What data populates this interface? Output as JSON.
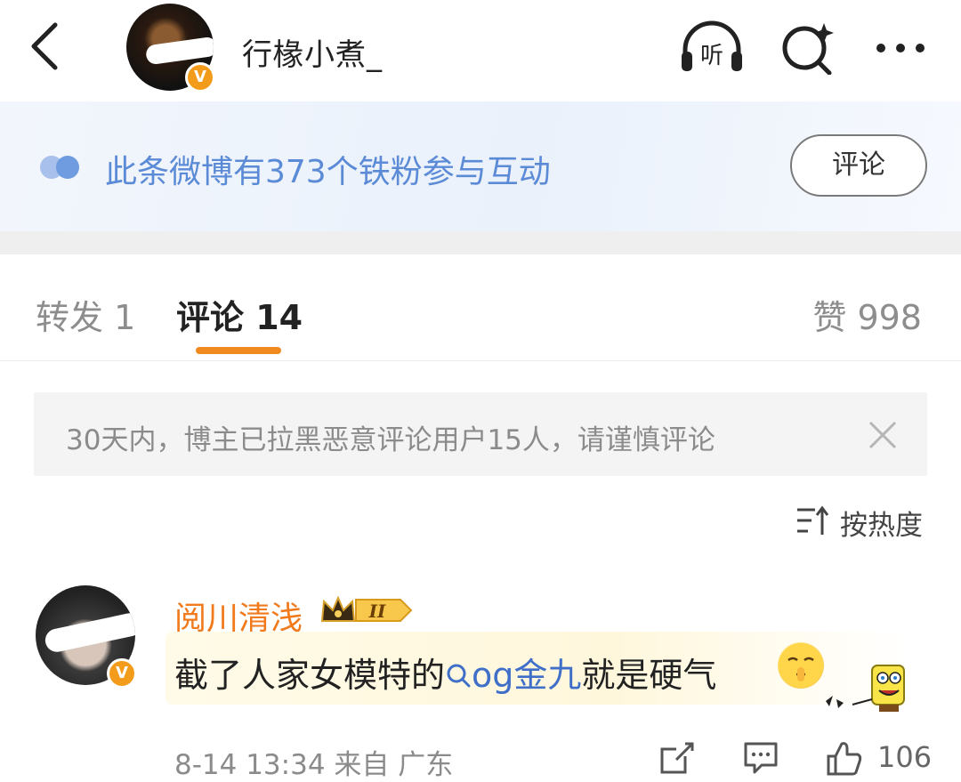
{
  "header": {
    "username": "行椽小煮_",
    "verified_badge": "V",
    "icons": [
      "back-arrow-icon",
      "listen-headphones-icon",
      "search-sparkle-icon",
      "more-dots-icon"
    ],
    "listen_label": "听"
  },
  "banner": {
    "text": "此条微博有373个铁粉参与互动",
    "button_label": "评论"
  },
  "tabs": {
    "repost": "转发 1",
    "comment": "评论 14",
    "like": "赞 998"
  },
  "notice": {
    "text": "30天内，博主已拉黑恶意评论用户15人，请谨慎评论"
  },
  "sort": {
    "label": "按热度"
  },
  "comment": {
    "username": "阅川清浅",
    "level_badge": "II",
    "text_before": "截了人家女模特的",
    "link_text": "og金九",
    "text_after": "就是硬气",
    "timestamp": "8-14 13:34",
    "source": "来自 广东",
    "like_count": "106"
  },
  "colors": {
    "accent_orange": "#f0891e",
    "link_blue": "#3f6fc8",
    "banner_blue": "#5b8ad6",
    "verified_orange": "#f39b1b"
  }
}
